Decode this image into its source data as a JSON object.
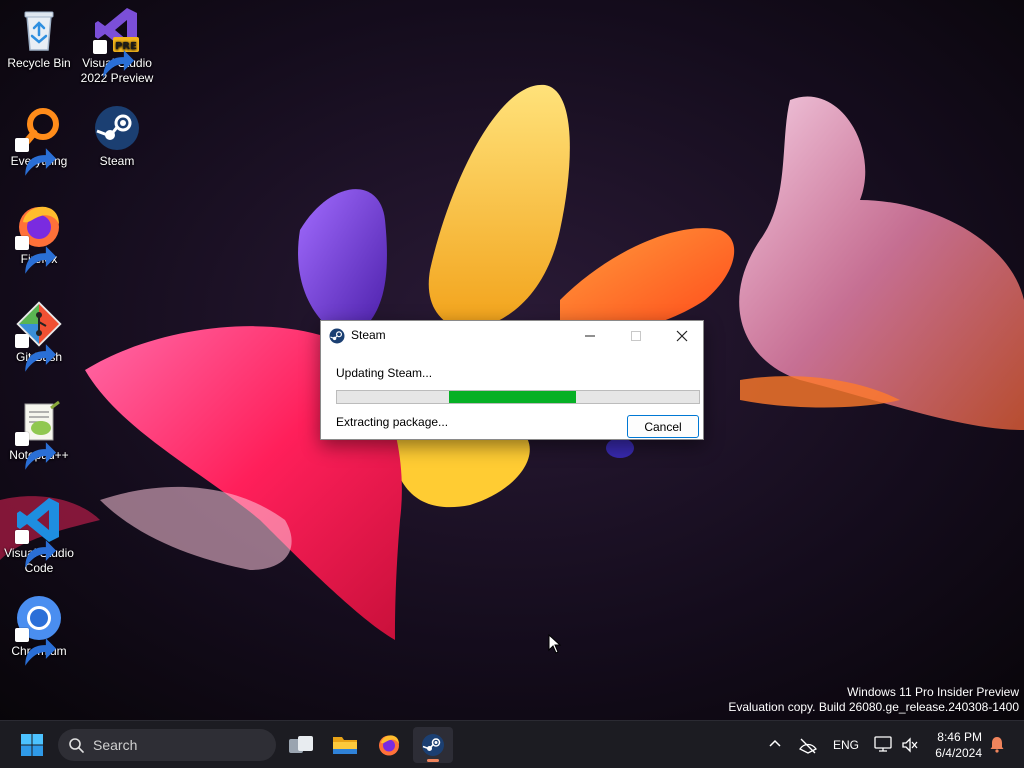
{
  "desktop": {
    "icons": [
      {
        "label_line1": "Recycle Bin",
        "label_line2": "",
        "icon": "recycle-bin-icon"
      },
      {
        "label_line1": "Visual Studio",
        "label_line2": "2022 Preview",
        "icon": "visual-studio-icon",
        "badge": "PRE"
      },
      {
        "label_line1": "Everything",
        "label_line2": "",
        "icon": "everything-icon"
      },
      {
        "label_line1": "Steam",
        "label_line2": "",
        "icon": "steam-icon"
      },
      {
        "label_line1": "Firefox",
        "label_line2": "",
        "icon": "firefox-icon"
      },
      {
        "label_line1": "Git Bash",
        "label_line2": "",
        "icon": "git-bash-icon"
      },
      {
        "label_line1": "Notepad++",
        "label_line2": "",
        "icon": "notepadpp-icon"
      },
      {
        "label_line1": "Visual Studio",
        "label_line2": "Code",
        "icon": "vscode-icon"
      },
      {
        "label_line1": "Chromium",
        "label_line2": "",
        "icon": "chromium-icon"
      }
    ]
  },
  "watermark": {
    "line1": "Windows 11 Pro Insider Preview",
    "line2": "Evaluation copy. Build 26080.ge_release.240308-1400"
  },
  "dialog": {
    "title": "Steam",
    "status": "Updating Steam...",
    "detail": "Extracting package...",
    "cancel_label": "Cancel",
    "progress": {
      "segment_start": 0.31,
      "segment_end": 0.66,
      "color": "#06b025"
    }
  },
  "taskbar": {
    "search_placeholder": "Search",
    "apps": [
      "start-icon",
      "task-view-icon",
      "file-explorer-icon",
      "firefox-icon",
      "steam-icon"
    ],
    "active_app": "steam-icon",
    "language": "ENG",
    "time": "8:46 PM",
    "date": "6/4/2024"
  },
  "colors": {
    "accent": "#0078d4",
    "taskbar_bg": "#1c1c22",
    "progress_green": "#06b025",
    "active_underline": "#f0845c"
  }
}
